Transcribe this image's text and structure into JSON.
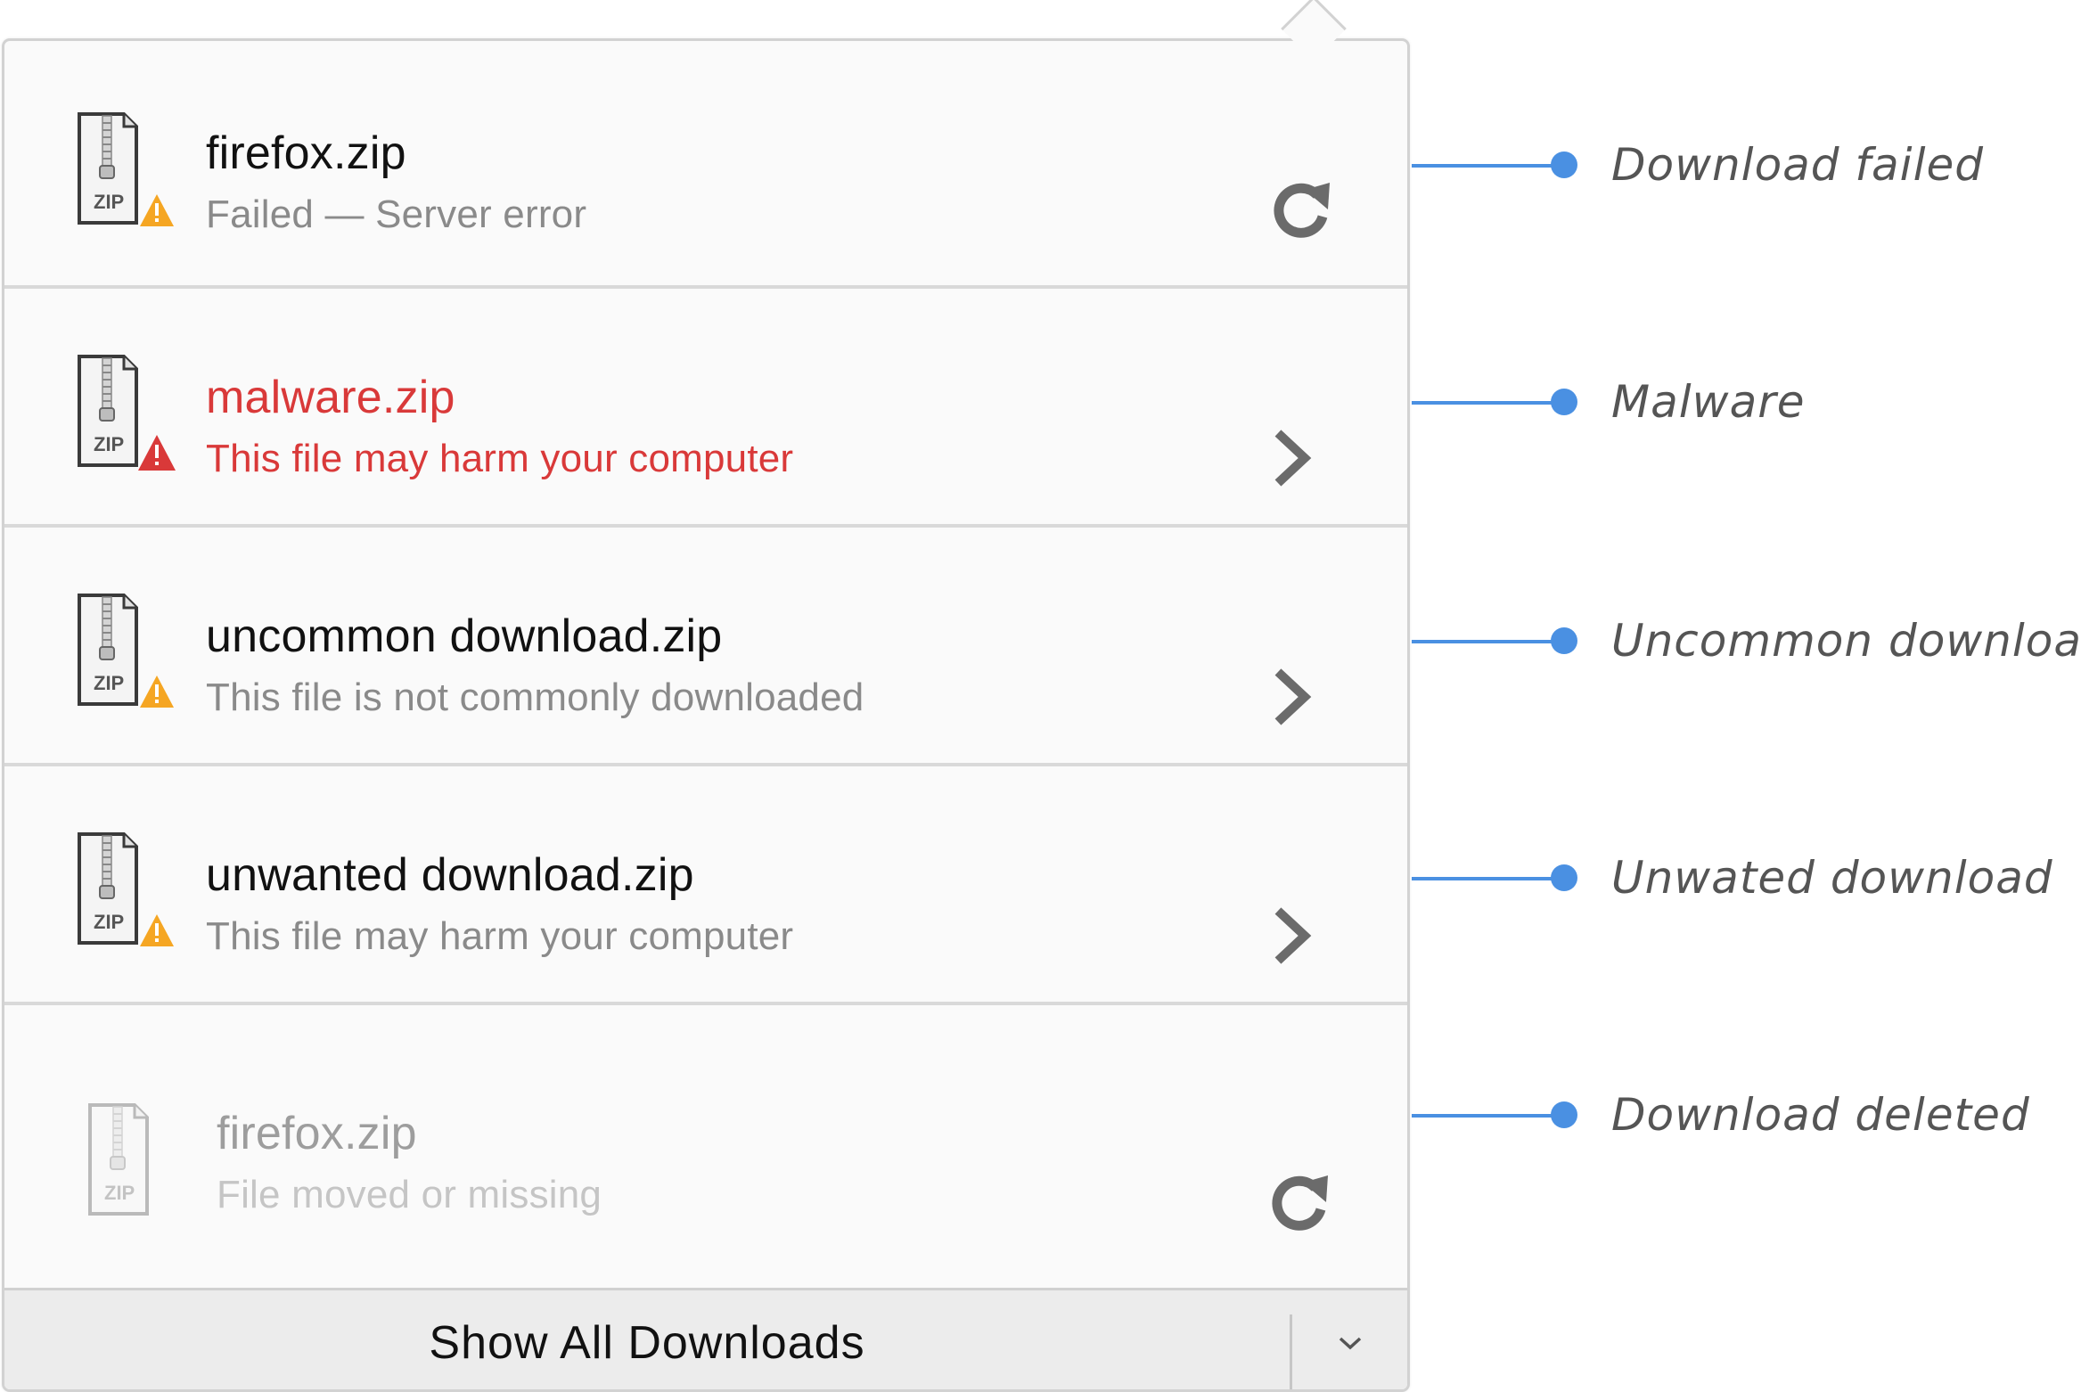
{
  "downloads": [
    {
      "name": "firefox.zip",
      "status": "Failed  —  Server error",
      "state": "failed",
      "icon": "zip-file-warning-icon",
      "action": "retry-icon",
      "callout": "Download failed"
    },
    {
      "name": "malware.zip",
      "status": "This file may harm your computer",
      "state": "malware",
      "icon": "zip-file-danger-icon",
      "action": "chevron-right-icon",
      "callout": "Malware"
    },
    {
      "name": "uncommon download.zip",
      "status": "This file is not commonly downloaded",
      "state": "uncommon",
      "icon": "zip-file-warning-icon",
      "action": "chevron-right-icon",
      "callout": "Uncommon download"
    },
    {
      "name": "unwanted download.zip",
      "status": "This file may harm your computer",
      "state": "unwanted",
      "icon": "zip-file-warning-icon",
      "action": "chevron-right-icon",
      "callout": "Unwated download"
    },
    {
      "name": "firefox.zip",
      "status": "File moved or missing",
      "state": "deleted",
      "icon": "zip-file-icon",
      "action": "retry-icon",
      "callout": "Download deleted"
    }
  ],
  "zip_label": "ZIP",
  "footer": {
    "show_all_label": "Show All Downloads",
    "more_icon": "chevron-down-icon"
  },
  "colors": {
    "callout_accent": "#4a90e2",
    "danger": "#d93939",
    "warning": "#f5a623",
    "panel_bg": "#fafafa",
    "footer_bg": "#ececec"
  }
}
